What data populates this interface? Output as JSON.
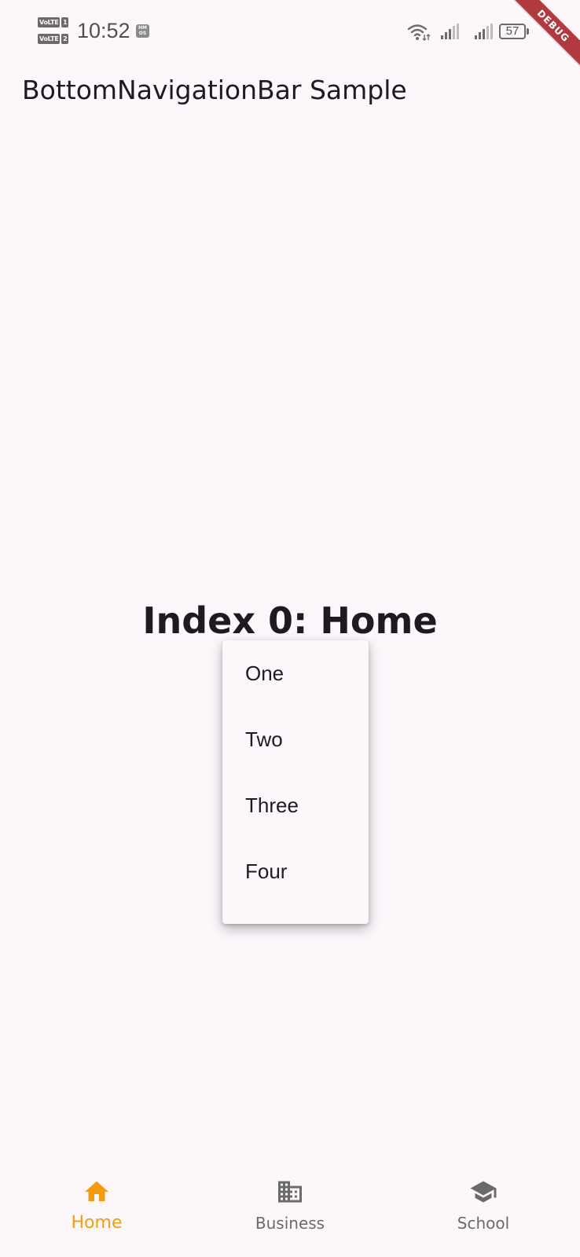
{
  "status_bar": {
    "volte_1": "VoLTE",
    "sim_1": "1",
    "volte_2": "VoLTE",
    "sim_2": "2",
    "time": "10:52",
    "hmos_badge": "HM OS",
    "battery": "57"
  },
  "debug_banner": "DEBUG",
  "app_bar": {
    "title": "BottomNavigationBar Sample"
  },
  "body": {
    "text": "Index 0: Home"
  },
  "popup_menu": {
    "items": [
      {
        "label": "One"
      },
      {
        "label": "Two"
      },
      {
        "label": "Three"
      },
      {
        "label": "Four"
      }
    ]
  },
  "bottom_nav": {
    "selected_index": 0,
    "active_color": "#f39c12",
    "inactive_color": "#6a6a6a",
    "items": [
      {
        "label": "Home",
        "icon": "home-icon"
      },
      {
        "label": "Business",
        "icon": "business-icon"
      },
      {
        "label": "School",
        "icon": "school-icon"
      }
    ]
  }
}
